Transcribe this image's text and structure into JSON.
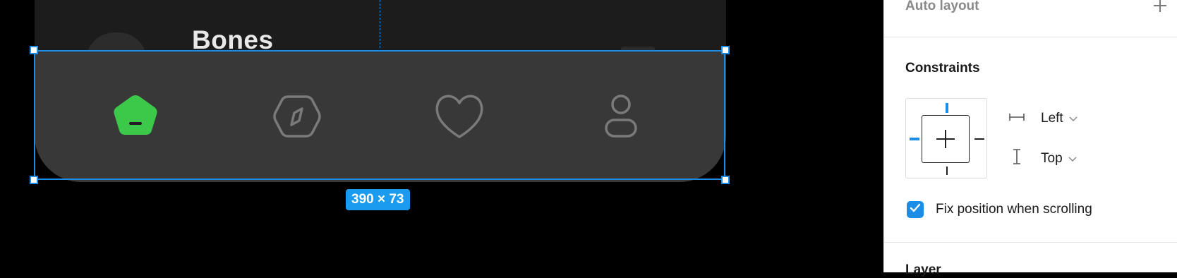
{
  "canvas": {
    "screen_title": "Bones",
    "selection_size": "390 × 73",
    "accent_color": "#1a8de8",
    "active_tab_color": "#3cc94a",
    "tabs": [
      {
        "icon": "home-pentagon-icon",
        "active": true
      },
      {
        "icon": "compass-icon",
        "active": false
      },
      {
        "icon": "heart-icon",
        "active": false
      },
      {
        "icon": "profile-icon",
        "active": false
      }
    ]
  },
  "panel": {
    "auto_layout": {
      "title": "Auto layout",
      "add_icon": "plus-icon"
    },
    "constraints": {
      "title": "Constraints",
      "horizontal": {
        "icon": "horizontal-constraint-icon",
        "value": "Left"
      },
      "vertical": {
        "icon": "vertical-constraint-icon",
        "value": "Top"
      },
      "fix_position": {
        "label": "Fix position when scrolling",
        "checked": true
      }
    },
    "layer": {
      "title": "Layer"
    }
  }
}
